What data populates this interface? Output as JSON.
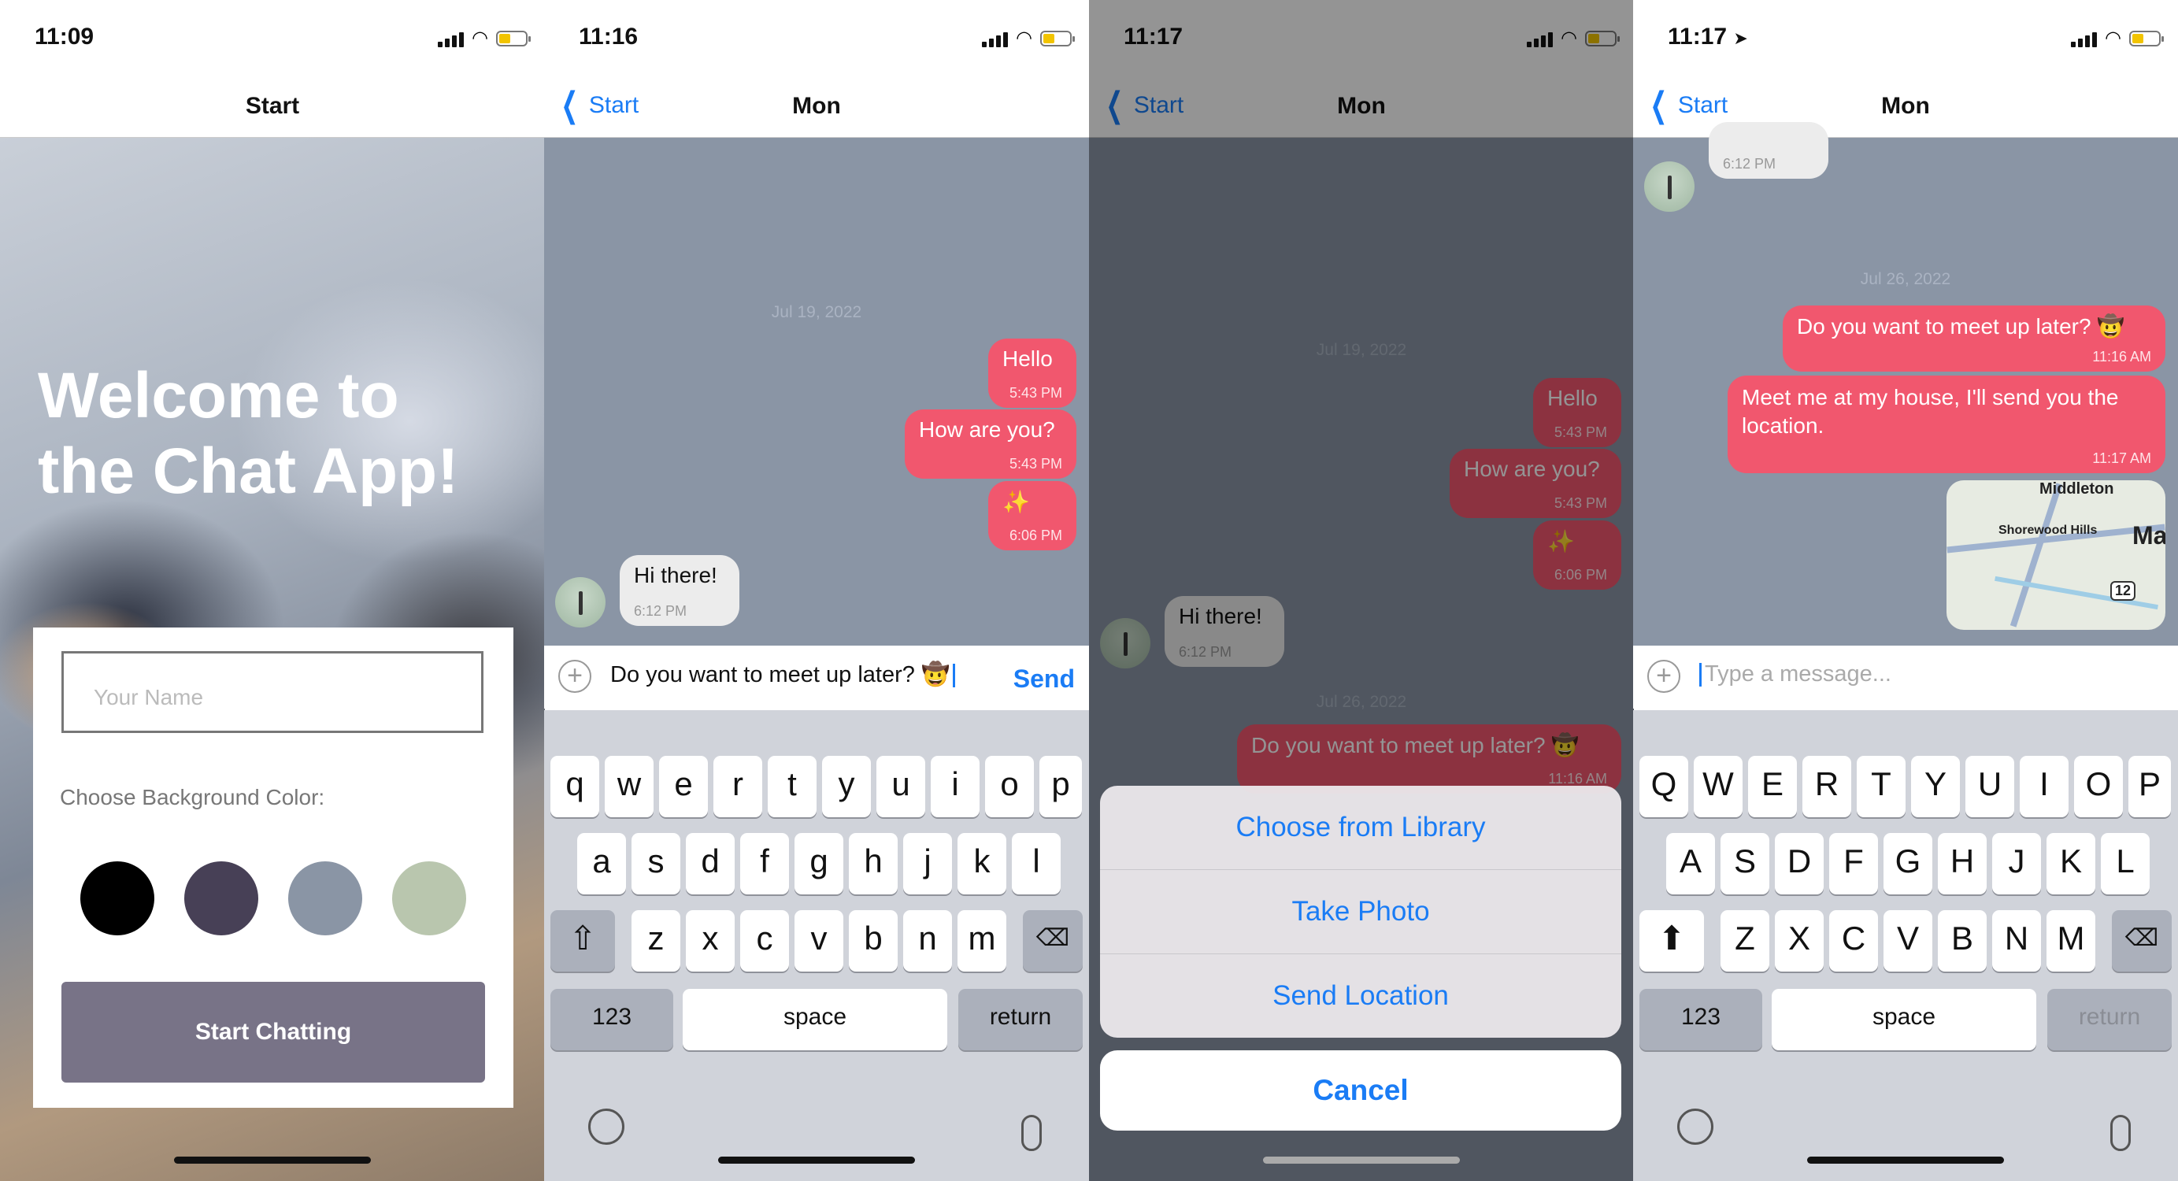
{
  "phones": [
    {
      "time": "11:09",
      "nav_title": "Start",
      "welcome_title": "Welcome to the Chat App!",
      "name_placeholder": "Your Name",
      "choose_label": "Choose Background Color:",
      "swatches": [
        "#000000",
        "#474056",
        "#8a95a5",
        "#b9c6ae"
      ],
      "start_button": "Start Chatting"
    },
    {
      "time": "11:16",
      "back_label": "Start",
      "nav_title": "Mon",
      "date_label": "Jul 19, 2022",
      "messages": [
        {
          "text": "Hello",
          "time": "5:43 PM",
          "side": "right"
        },
        {
          "text": "How are you?",
          "time": "5:43 PM",
          "side": "right"
        },
        {
          "text": "✨",
          "time": "6:06 PM",
          "side": "right"
        },
        {
          "text": "Hi there!",
          "time": "6:12 PM",
          "side": "left"
        }
      ],
      "input_text": "Do you want to meet up later? 🤠",
      "send_label": "Send",
      "keyboard": {
        "row1": [
          "q",
          "w",
          "e",
          "r",
          "t",
          "y",
          "u",
          "i",
          "o",
          "p"
        ],
        "row2": [
          "a",
          "s",
          "d",
          "f",
          "g",
          "h",
          "j",
          "k",
          "l"
        ],
        "row3": [
          "z",
          "x",
          "c",
          "v",
          "b",
          "n",
          "m"
        ],
        "num": "123",
        "space": "space",
        "return": "return"
      }
    },
    {
      "time": "11:17",
      "back_label": "Start",
      "nav_title": "Mon",
      "date_label_1": "Jul 19, 2022",
      "date_label_2": "Jul 26, 2022",
      "messages": [
        {
          "text": "Hello",
          "time": "5:43 PM"
        },
        {
          "text": "How are you?",
          "time": "5:43 PM"
        },
        {
          "text": "✨",
          "time": "6:06 PM"
        },
        {
          "text": "Hi there!",
          "time": "6:12 PM"
        },
        {
          "text": "Do you want to meet up later? 🤠",
          "time": "11:16 AM"
        }
      ],
      "actions": [
        "Choose from Library",
        "Take Photo",
        "Send Location"
      ],
      "cancel_label": "Cancel"
    },
    {
      "time": "11:17",
      "back_label": "Start",
      "nav_title": "Mon",
      "prev_time": "6:12 PM",
      "date_label": "Jul 26, 2022",
      "messages": [
        {
          "text": "Do you want to meet up later? 🤠",
          "time": "11:16 AM"
        },
        {
          "text": "Meet me at my house, I'll send you the location.",
          "time": "11:17 AM"
        }
      ],
      "map_labels": {
        "city1": "Middleton",
        "city2": "Shorewood Hills",
        "city3": "Ma",
        "route": "12"
      },
      "input_placeholder": "Type a message...",
      "keyboard": {
        "row1": [
          "Q",
          "W",
          "E",
          "R",
          "T",
          "Y",
          "U",
          "I",
          "O",
          "P"
        ],
        "row2": [
          "A",
          "S",
          "D",
          "F",
          "G",
          "H",
          "J",
          "K",
          "L"
        ],
        "row3": [
          "Z",
          "X",
          "C",
          "V",
          "B",
          "N",
          "M"
        ],
        "num": "123",
        "space": "space",
        "return": "return"
      }
    }
  ]
}
